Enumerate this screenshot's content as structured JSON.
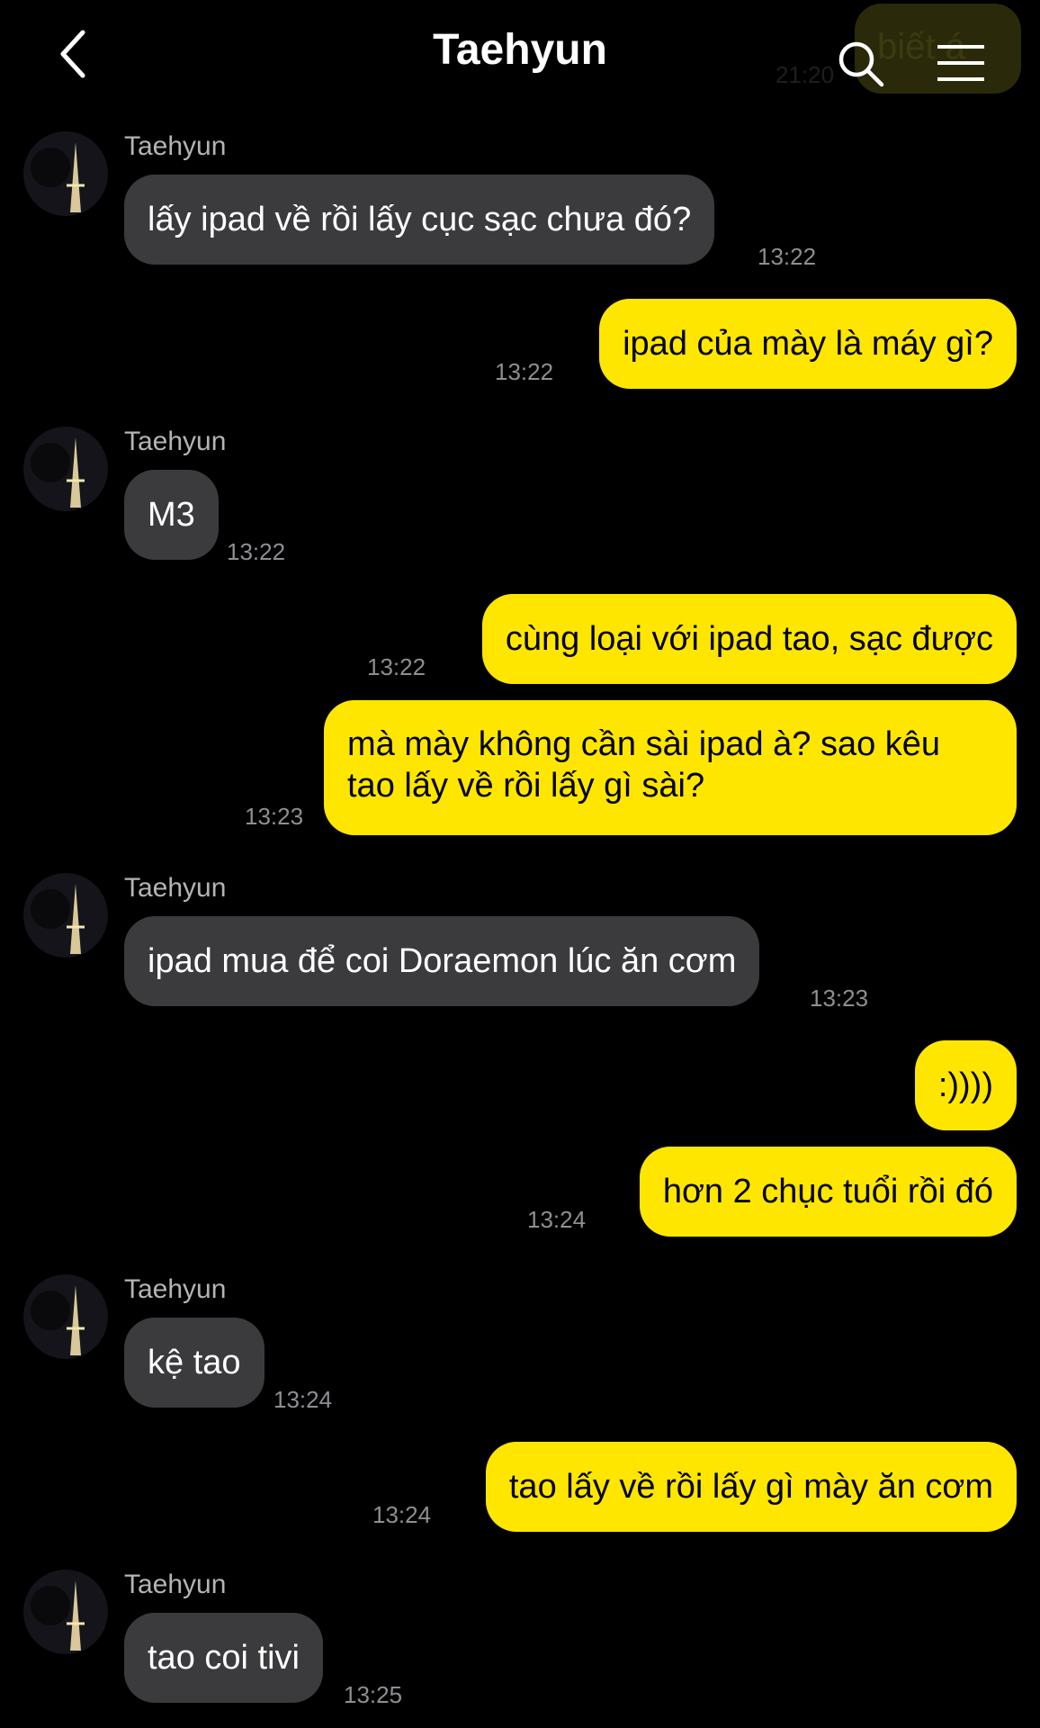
{
  "header": {
    "title": "Taehyun",
    "back_icon": "chevron-left-icon",
    "search_icon": "search-icon",
    "menu_icon": "hamburger-menu-icon"
  },
  "background_preview": {
    "text": "biết á",
    "time": "21:20"
  },
  "colors": {
    "background": "#000000",
    "incoming_bubble": "#3b3b3d",
    "outgoing_bubble": "#ffe600",
    "timestamp": "#8e8e93",
    "sender_name": "#b4b4b4"
  },
  "messages": [
    {
      "direction": "in",
      "sender": "Taehyun",
      "text": "lấy ipad về rồi lấy cục sạc chưa đó?",
      "time": "13:22"
    },
    {
      "direction": "out",
      "text": "ipad của mày là máy gì?",
      "time": "13:22"
    },
    {
      "direction": "in",
      "sender": "Taehyun",
      "text": "M3",
      "time": "13:22"
    },
    {
      "direction": "out",
      "text": "cùng loại với ipad tao, sạc được",
      "time": "13:22"
    },
    {
      "direction": "out",
      "text": "mà mày không cần sài ipad à? sao kêu tao lấy về rồi lấy gì sài?",
      "time": "13:23"
    },
    {
      "direction": "in",
      "sender": "Taehyun",
      "text": "ipad mua để coi Doraemon lúc ăn cơm",
      "time": "13:23"
    },
    {
      "direction": "out",
      "text": ":))))",
      "time": ""
    },
    {
      "direction": "out",
      "text": "hơn 2 chục tuổi rồi đó",
      "time": "13:24"
    },
    {
      "direction": "in",
      "sender": "Taehyun",
      "text": "kệ tao",
      "time": "13:24"
    },
    {
      "direction": "out",
      "text": "tao lấy về rồi lấy gì mày ăn cơm",
      "time": "13:24"
    },
    {
      "direction": "in",
      "sender": "Taehyun",
      "text": "tao coi tivi",
      "time": "13:25"
    }
  ]
}
